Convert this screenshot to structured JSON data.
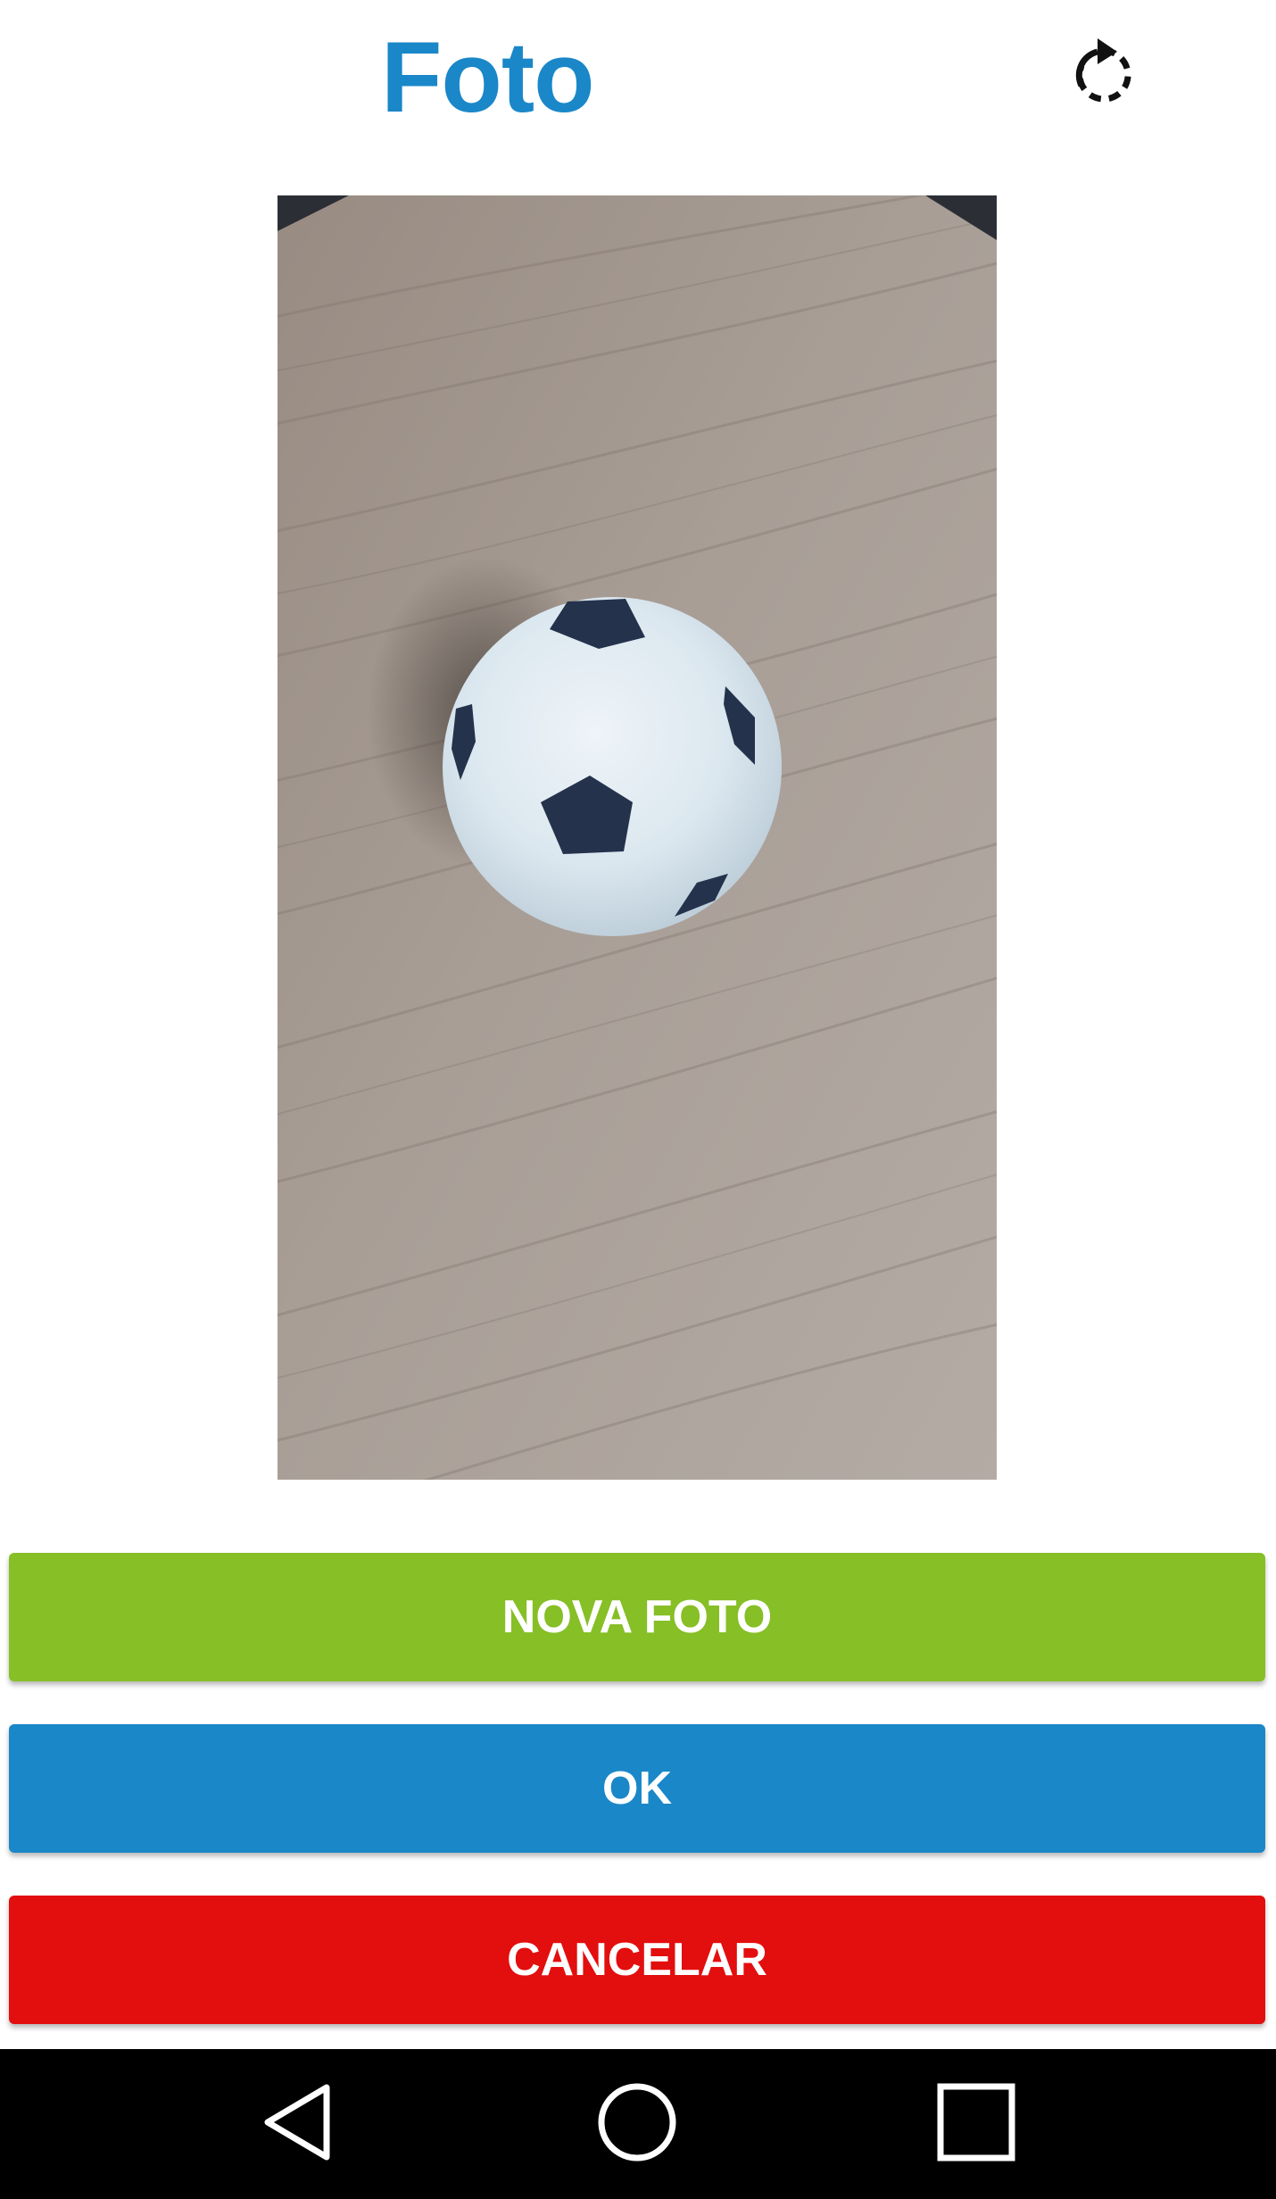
{
  "header": {
    "title": "Foto",
    "rotate_icon": "rotate-clockwise-icon"
  },
  "photo": {
    "description_icon": "captured-photo"
  },
  "buttons": {
    "new_photo_label": "NOVA FOTO",
    "ok_label": "OK",
    "cancel_label": "CANCELAR"
  },
  "colors": {
    "title": "#1a87c8",
    "new_photo": "#86bf26",
    "ok": "#1a87c8",
    "cancel": "#e30e0e",
    "nav_bar": "#000000"
  },
  "nav": {
    "back_icon": "back-triangle-icon",
    "home_icon": "home-circle-icon",
    "recents_icon": "recents-square-icon"
  }
}
